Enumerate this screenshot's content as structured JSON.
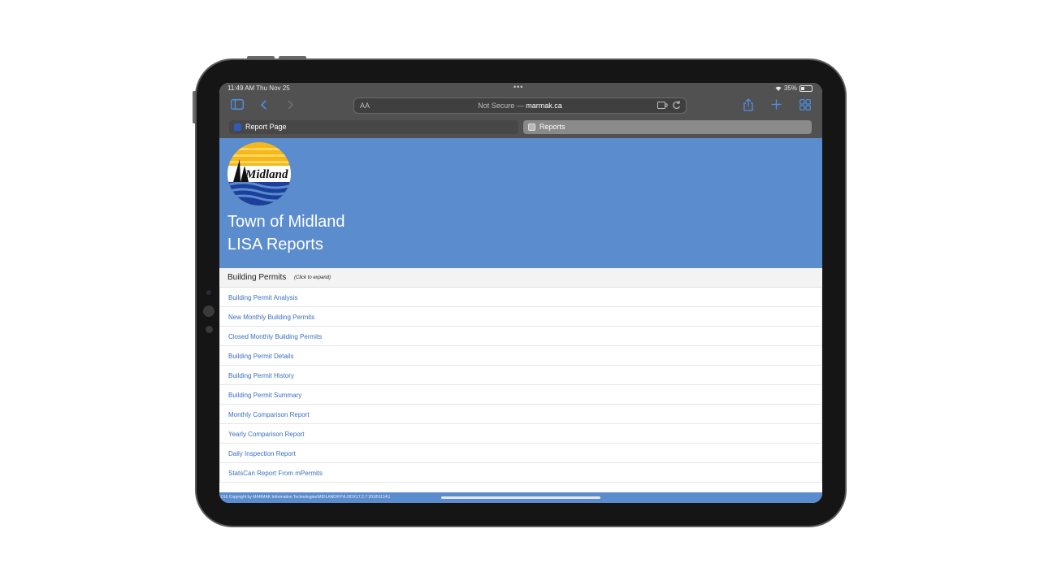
{
  "status_bar": {
    "time": "11:49 AM  Thu Nov 25",
    "dots": "•••",
    "battery": "35%"
  },
  "toolbar": {
    "icons": [
      "sidebar-icon",
      "back-icon",
      "forward-icon",
      "share-icon",
      "plus-icon",
      "tabs-grid-icon"
    ],
    "accent": "#4f8fe6"
  },
  "url_bar": {
    "aa": "AA",
    "prefix": "Not Secure — ",
    "host": "marmak.ca"
  },
  "tabs": [
    {
      "label": "Report Page",
      "active": false
    },
    {
      "label": "Reports",
      "active": true
    }
  ],
  "banner": {
    "logo_text": "Midland",
    "line1": "Town of Midland",
    "line2": "LISA Reports",
    "color": "#5b8ccd"
  },
  "section": {
    "title": "Building Permits",
    "hint": "(Click to expand)"
  },
  "reports": [
    "Building Permit Analysis",
    "New Monthly Building Permits",
    "Closed Monthly Building Permits",
    "Building Permit Details",
    "Building Permit History",
    "Building Permit Summary",
    "Monthly Comparison Report",
    "Yearly Comparison Report",
    "Daily Inspection Report",
    "StatsCan Report From mPermits"
  ],
  "footer": {
    "text": "016 Copyright by MARMAK Information Technologies\\MIDLAND\\FF\\6.0/DX17.2.7 2018\\1114\\1"
  }
}
